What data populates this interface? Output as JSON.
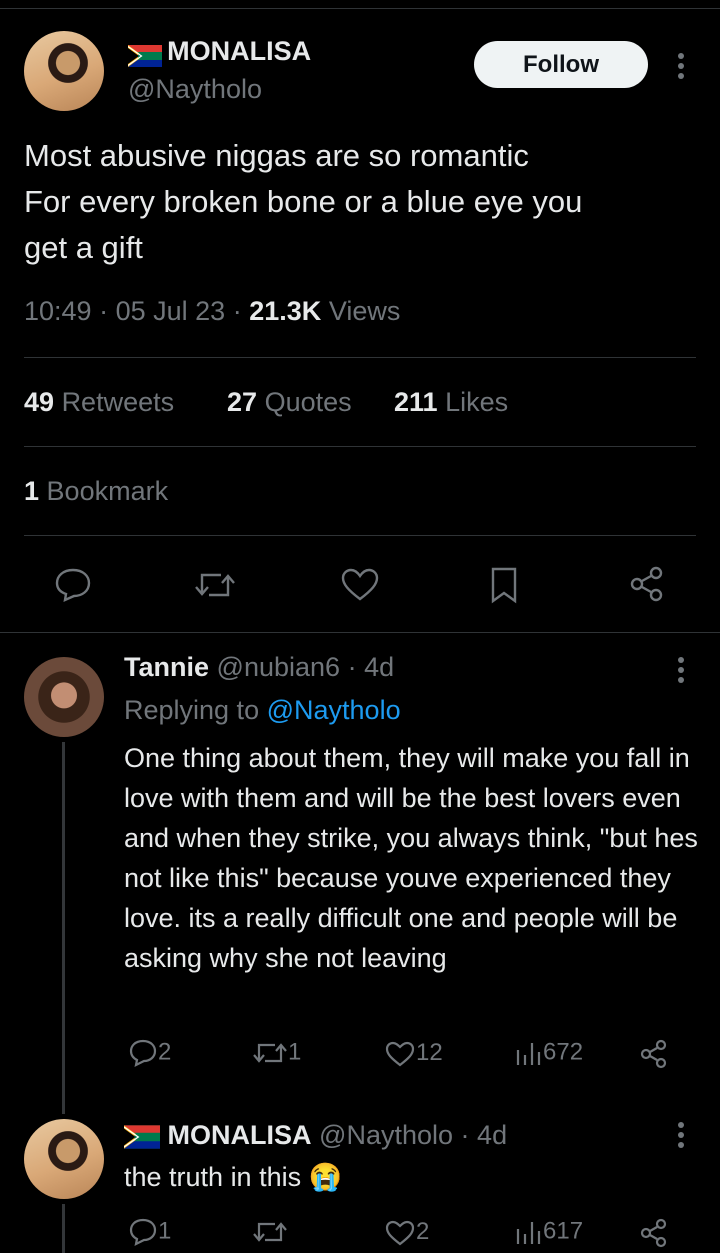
{
  "main_tweet": {
    "display_name": "MONALISA",
    "handle": "@Naytholo",
    "follow_label": "Follow",
    "text_lines": [
      "Most abusive niggas are so romantic",
      "For every broken bone or a blue eye you",
      "get a gift"
    ],
    "time": "10:49",
    "date": "05 Jul 23",
    "views_count": "21.3K",
    "views_label": "Views",
    "retweets_count": "49",
    "retweets_label": "Retweets",
    "quotes_count": "27",
    "quotes_label": "Quotes",
    "likes_count": "211",
    "likes_label": "Likes",
    "bookmarks_count": "1",
    "bookmarks_label": "Bookmark",
    "sep": "·"
  },
  "reply1": {
    "display_name": "Tannie",
    "handle": "@nubian6",
    "age": "4d",
    "replying_prefix": "Replying to",
    "replying_to": "@Naytholo",
    "text": "One thing about them, they will make you fall in love with them and will be the best lovers even and when they strike, you always think, \"but hes not like this\" because youve experienced they love. its a really difficult one and people will be asking why she not leaving",
    "replies": "2",
    "retweets": "1",
    "likes": "12",
    "views": "672"
  },
  "reply2": {
    "display_name": "MONALISA",
    "handle": "@Naytholo",
    "age": "4d",
    "text": "the truth in this 😭",
    "replies": "1",
    "retweets": "",
    "likes": "2",
    "views": "617"
  },
  "colors": {
    "background": "#000000",
    "text": "#e7e9ea",
    "muted": "#71767b",
    "link": "#1d9bf0",
    "divider": "#2f3336"
  },
  "icons": [
    "south-africa-flag-icon",
    "more-dots-icon",
    "reply-icon",
    "retweet-icon",
    "like-icon",
    "bookmark-icon",
    "share-icon",
    "views-icon"
  ]
}
